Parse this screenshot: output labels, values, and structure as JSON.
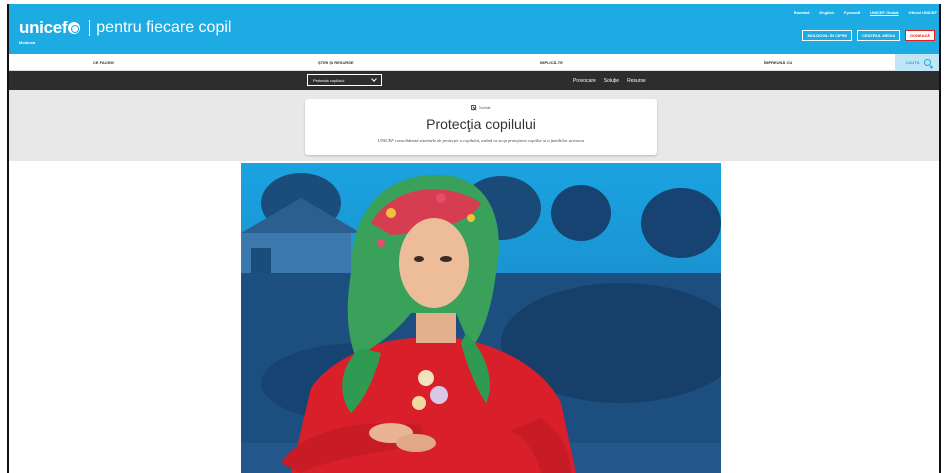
{
  "header": {
    "logo_brand": "unicef",
    "logo_tagline": "pentru fiecare copil",
    "country": "Moldova",
    "top_links": [
      "Română",
      "English",
      "Русский",
      "UNICEF Global",
      "Oficiul UNICEF"
    ],
    "buttons": {
      "about": "MOLDOVA: ÎN CIFRE",
      "media": "CENTRUL MEDIA",
      "donate": "DONEAZĂ"
    }
  },
  "nav": {
    "items": [
      "CE FACEM",
      "ȘTIRI ȘI RESURSE",
      "IMPLICĂ-TE",
      "ÎMPREUNĂ CU"
    ],
    "search_label": "CAUTĂ"
  },
  "subnav": {
    "select_value": "Protecția copilului",
    "links": [
      "Provocare",
      "Soluție",
      "Resurse"
    ]
  },
  "card": {
    "close_label": "Închide",
    "title": "Protecţia copilului",
    "subtitle": "UNICEF consolidează sistemele de protecție a copilului, având ca scop protejarea copiilor și a familiilor acestora"
  },
  "hero": {
    "alt": "child-photo"
  },
  "colors": {
    "brand_blue": "#1cabe2",
    "donate_red": "#e2231a",
    "subnav_bg": "#2d2d2d",
    "band_bg": "#e8e8e8"
  }
}
